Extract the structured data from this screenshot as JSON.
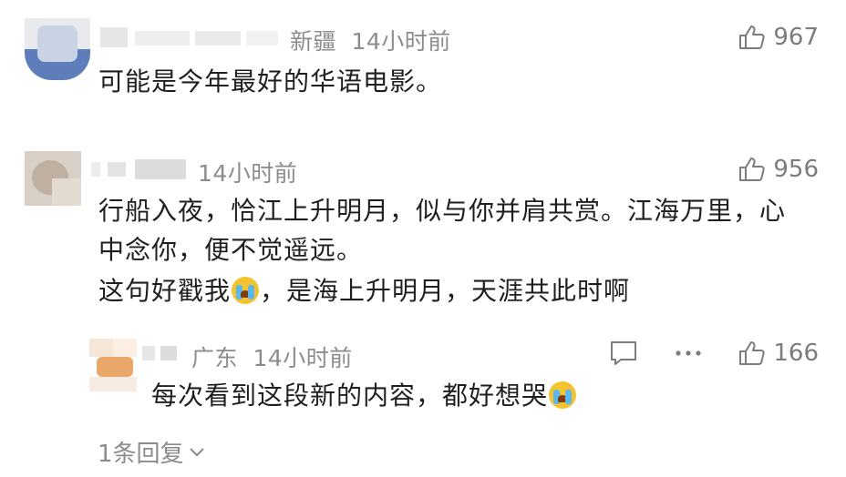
{
  "comments": [
    {
      "location": "新疆",
      "time": "14小时前",
      "likes": "967",
      "lines": [
        "可能是今年最好的华语电影。"
      ]
    },
    {
      "location": "",
      "time": "14小时前",
      "likes": "956",
      "lines": [
        "行船入夜，恰江上升明月，似与你并肩共赏。江海万里，心",
        "中念你，便不觉遥远。"
      ],
      "line3_a": "这句好戳我",
      "line3_b": "，是海上升明月，天涯共此时啊",
      "reply": {
        "location": "广东",
        "time": "14小时前",
        "likes": "166",
        "text": "每次看到这段新的内容，都好想哭"
      },
      "more_replies": "1条回复"
    }
  ],
  "icons": {
    "like": "thumb-up-icon",
    "comment": "comment-bubble-icon",
    "more": "more-dots-icon",
    "expand": "chevron-down-icon",
    "emoji": "loudly-crying-emoji-icon"
  },
  "colors": {
    "meta": "#8c8c8c",
    "text": "#1f1f1f",
    "emoji": "#f4c430"
  }
}
